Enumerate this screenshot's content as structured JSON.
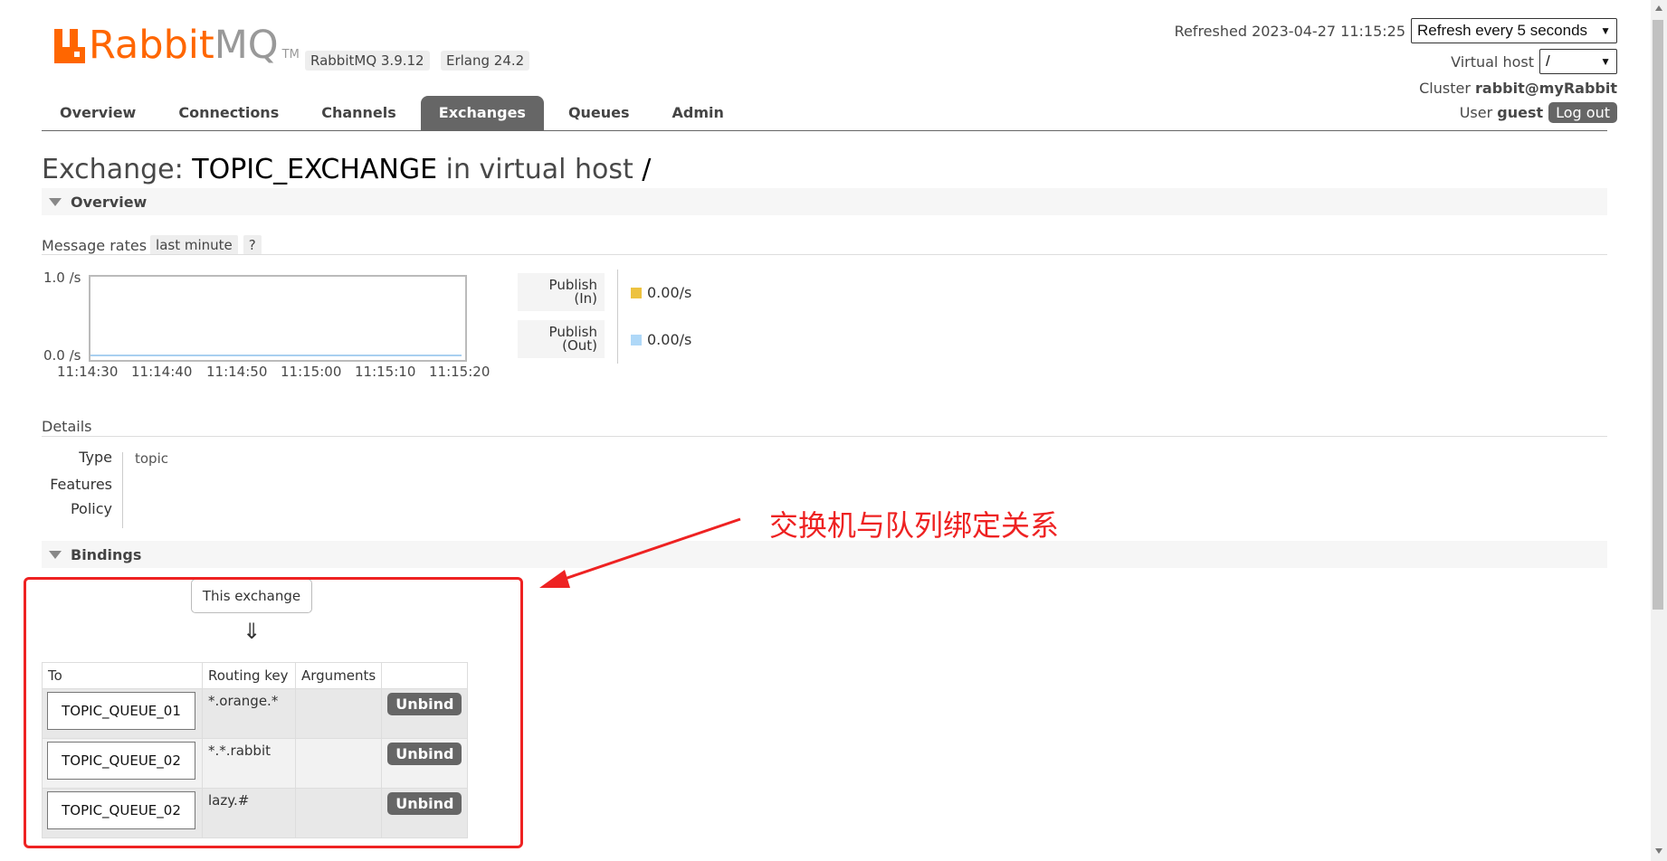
{
  "header": {
    "logo_rabbit": "Rabbit",
    "logo_mq": "MQ",
    "logo_tm": "TM",
    "version_badge": "RabbitMQ 3.9.12",
    "erlang_badge": "Erlang 24.2",
    "refreshed_text": "Refreshed 2023-04-27 11:15:25",
    "refresh_select_value": "Refresh every 5 seconds",
    "virtual_host_label": "Virtual host",
    "virtual_host_value": "/",
    "cluster_label": "Cluster",
    "cluster_value": "rabbit@myRabbit",
    "user_label": "User",
    "user_value": "guest",
    "logout_label": "Log out"
  },
  "tabs": [
    {
      "label": "Overview",
      "active": false
    },
    {
      "label": "Connections",
      "active": false
    },
    {
      "label": "Channels",
      "active": false
    },
    {
      "label": "Exchanges",
      "active": true
    },
    {
      "label": "Queues",
      "active": false
    },
    {
      "label": "Admin",
      "active": false
    }
  ],
  "title": {
    "prefix": "Exchange:",
    "exchange_name": "TOPIC_EXCHANGE",
    "middle": "in virtual host",
    "vhost": "/"
  },
  "overview_section": {
    "label": "Overview",
    "message_rates_label": "Message rates",
    "range_pill": "last minute",
    "help_pill": "?",
    "chart": {
      "y_top": "1.0 /s",
      "y_bottom": "0.0 /s",
      "x_ticks": [
        "11:14:30",
        "11:14:40",
        "11:14:50",
        "11:15:00",
        "11:15:10",
        "11:15:20"
      ]
    },
    "legend": [
      {
        "name_line1": "Publish",
        "name_line2": "(In)",
        "value": "0.00/s",
        "color": "#edc240"
      },
      {
        "name_line1": "Publish",
        "name_line2": "(Out)",
        "value": "0.00/s",
        "color": "#afd8f8"
      }
    ]
  },
  "chart_data": {
    "type": "line",
    "x": [
      "11:14:30",
      "11:14:40",
      "11:14:50",
      "11:15:00",
      "11:15:10",
      "11:15:20"
    ],
    "series": [
      {
        "name": "Publish (In)",
        "values": [
          0,
          0,
          0,
          0,
          0,
          0
        ],
        "color": "#edc240"
      },
      {
        "name": "Publish (Out)",
        "values": [
          0,
          0,
          0,
          0,
          0,
          0
        ],
        "color": "#afd8f8"
      }
    ],
    "ylim": [
      0,
      1.0
    ],
    "ytick_labels": [
      "0.0 /s",
      "1.0 /s"
    ]
  },
  "details": {
    "label": "Details",
    "rows": [
      {
        "label": "Type",
        "value": "topic"
      },
      {
        "label": "Features",
        "value": ""
      },
      {
        "label": "Policy",
        "value": ""
      }
    ]
  },
  "bindings": {
    "label": "Bindings",
    "this_exchange": "This exchange",
    "arrow": "⇓",
    "columns": [
      "To",
      "Routing key",
      "Arguments",
      ""
    ],
    "rows": [
      {
        "to": "TOPIC_QUEUE_01",
        "routing_key": "*.orange.*",
        "arguments": "",
        "action": "Unbind"
      },
      {
        "to": "TOPIC_QUEUE_02",
        "routing_key": "*.*.rabbit",
        "arguments": "",
        "action": "Unbind"
      },
      {
        "to": "TOPIC_QUEUE_02",
        "routing_key": "lazy.#",
        "arguments": "",
        "action": "Unbind"
      }
    ]
  },
  "annotation": {
    "text": "交换机与队列绑定关系",
    "color": "#ee2222"
  }
}
